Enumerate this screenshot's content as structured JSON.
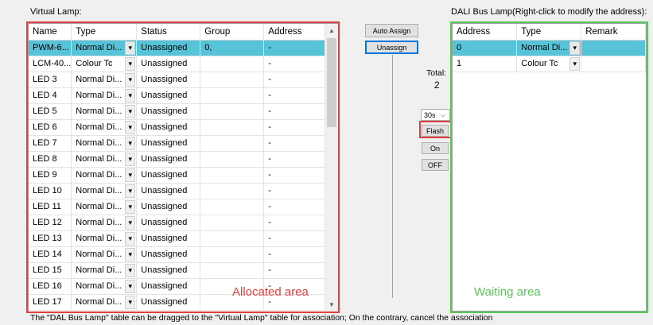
{
  "virtual": {
    "label": "Virtual Lamp:",
    "columns": [
      "Name",
      "Type",
      "Status",
      "Group",
      "Address"
    ],
    "rows": [
      {
        "name": "PWM-6...",
        "type": "Normal Di...",
        "status": "Unassigned",
        "group": "0,",
        "address": "-",
        "selected": true
      },
      {
        "name": "LCM-40...",
        "type": "Colour Tc",
        "status": "Unassigned",
        "group": "",
        "address": "-"
      },
      {
        "name": "LED 3",
        "type": "Normal Di...",
        "status": "Unassigned",
        "group": "",
        "address": "-"
      },
      {
        "name": "LED 4",
        "type": "Normal Di...",
        "status": "Unassigned",
        "group": "",
        "address": "-"
      },
      {
        "name": "LED 5",
        "type": "Normal Di...",
        "status": "Unassigned",
        "group": "",
        "address": "-"
      },
      {
        "name": "LED 6",
        "type": "Normal Di...",
        "status": "Unassigned",
        "group": "",
        "address": "-"
      },
      {
        "name": "LED 7",
        "type": "Normal Di...",
        "status": "Unassigned",
        "group": "",
        "address": "-"
      },
      {
        "name": "LED 8",
        "type": "Normal Di...",
        "status": "Unassigned",
        "group": "",
        "address": "-"
      },
      {
        "name": "LED 9",
        "type": "Normal Di...",
        "status": "Unassigned",
        "group": "",
        "address": "-"
      },
      {
        "name": "LED 10",
        "type": "Normal Di...",
        "status": "Unassigned",
        "group": "",
        "address": "-"
      },
      {
        "name": "LED 11",
        "type": "Normal Di...",
        "status": "Unassigned",
        "group": "",
        "address": "-"
      },
      {
        "name": "LED 12",
        "type": "Normal Di...",
        "status": "Unassigned",
        "group": "",
        "address": "-"
      },
      {
        "name": "LED 13",
        "type": "Normal Di...",
        "status": "Unassigned",
        "group": "",
        "address": "-"
      },
      {
        "name": "LED 14",
        "type": "Normal Di...",
        "status": "Unassigned",
        "group": "",
        "address": "-"
      },
      {
        "name": "LED 15",
        "type": "Normal Di...",
        "status": "Unassigned",
        "group": "",
        "address": "-"
      },
      {
        "name": "LED 16",
        "type": "Normal Di...",
        "status": "Unassigned",
        "group": "",
        "address": "-"
      },
      {
        "name": "LED 17",
        "type": "Normal Di...",
        "status": "Unassigned",
        "group": "",
        "address": "-"
      }
    ],
    "area_label": "Allocated area"
  },
  "dali": {
    "label": "DALI Bus Lamp(Right-click to modify the address):",
    "columns": [
      "Address",
      "Type",
      "Remark"
    ],
    "rows": [
      {
        "address": "0",
        "type": "Normal Di...",
        "remark": "",
        "selected": true
      },
      {
        "address": "1",
        "type": "Colour Tc",
        "remark": ""
      }
    ],
    "area_label": "Waiting area"
  },
  "controls": {
    "auto_assign": "Auto Assign",
    "unassign": "Unassign",
    "total_label": "Total:",
    "total_value": "2",
    "duration": "30s",
    "flash": "Flash",
    "on": "On",
    "off": "OFF"
  },
  "footer": "The \"DAL Bus Lamp\" table can be dragged to the \"Virtual Lamp\" table for association; On the contrary, cancel the association",
  "colors": {
    "selected_row": "#56c3d9",
    "highlight_red": "#e04040",
    "highlight_green": "#55c855"
  }
}
